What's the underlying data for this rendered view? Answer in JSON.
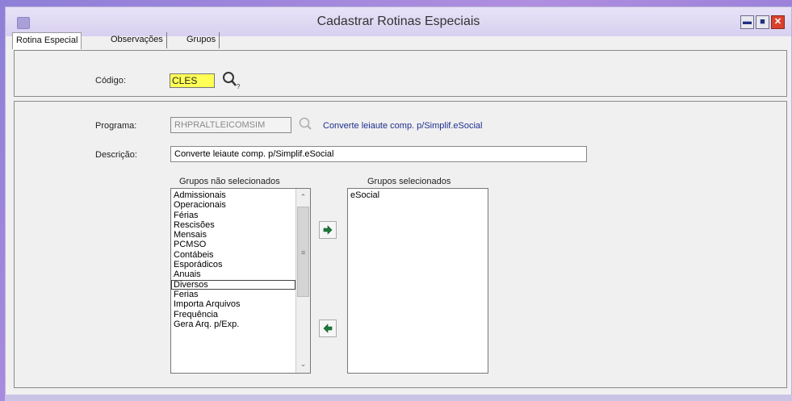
{
  "window": {
    "title": "Cadastrar Rotinas Especiais",
    "controls": {
      "minimize": "▬",
      "maximize": "■",
      "close": "✕"
    }
  },
  "tabs": [
    {
      "label": "Rotina Especial",
      "active": true
    },
    {
      "label": "Observações",
      "active": false
    },
    {
      "label": "Grupos",
      "active": false
    }
  ],
  "codigo": {
    "label": "Código:",
    "value": "CLES",
    "highlight_color": "#ffff55",
    "lookup_icon": "search-icon"
  },
  "programa": {
    "label": "Programa:",
    "value": "RHPRALTLEICOMSIM",
    "lookup_icon": "search-icon",
    "description": "Converte leiaute comp. p/Simplif.eSocial"
  },
  "descricao": {
    "label": "Descrição:",
    "value": "Converte leiaute comp. p/Simplif.eSocial"
  },
  "grupos_nao_selecionados": {
    "header": "Grupos não selecionados",
    "items": [
      "Admissionais",
      "Operacionais",
      "Férias",
      "Rescisões",
      "Mensais",
      "PCMSO",
      "Contábeis",
      "Esporádicos",
      "Anuais",
      "Diversos",
      "Ferias",
      "Importa Arquivos",
      "Frequência",
      "Gera Arq. p/Exp."
    ],
    "focused_item": "Diversos"
  },
  "grupos_selecionados": {
    "header": "Grupos selecionados",
    "items": [
      "eSocial"
    ]
  },
  "buttons": {
    "add_icon": "arrow-right-icon",
    "remove_icon": "arrow-left-icon",
    "arrow_color": "#1a7a3a"
  }
}
